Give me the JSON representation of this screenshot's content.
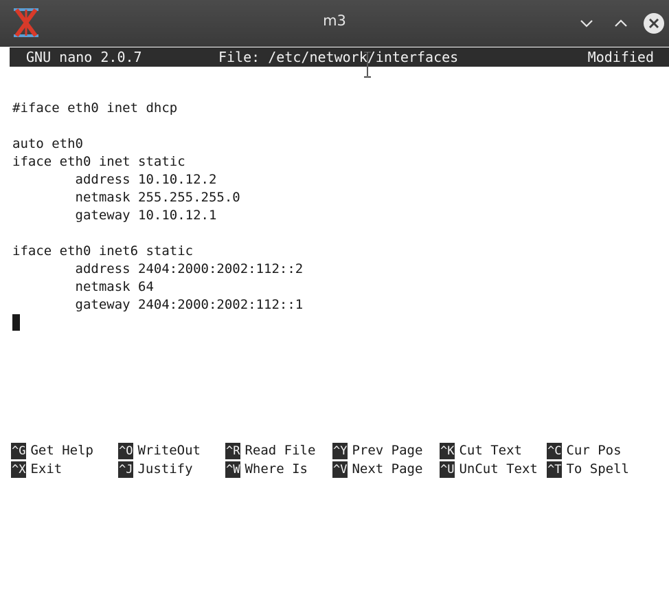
{
  "window": {
    "title": "m3",
    "icons": [
      "app-x-icon",
      "minimize-icon",
      "maximize-icon",
      "close-icon"
    ]
  },
  "nano": {
    "version": "GNU nano 2.0.7",
    "file": "File: /etc/network/interfaces",
    "status": "Modified"
  },
  "editor": {
    "lines": [
      "",
      "#iface eth0 inet dhcp",
      "",
      "auto eth0",
      "iface eth0 inet static",
      "        address 10.10.12.2",
      "        netmask 255.255.255.0",
      "        gateway 10.10.12.1",
      "",
      "iface eth0 inet6 static",
      "        address 2404:2000:2002:112::2",
      "        netmask 64",
      "        gateway 2404:2000:2002:112::1"
    ]
  },
  "shortcuts": {
    "row1": [
      {
        "key": "^G",
        "label": "Get Help"
      },
      {
        "key": "^O",
        "label": "WriteOut"
      },
      {
        "key": "^R",
        "label": "Read File"
      },
      {
        "key": "^Y",
        "label": "Prev Page"
      },
      {
        "key": "^K",
        "label": "Cut Text"
      },
      {
        "key": "^C",
        "label": "Cur Pos"
      }
    ],
    "row2": [
      {
        "key": "^X",
        "label": "Exit"
      },
      {
        "key": "^J",
        "label": "Justify"
      },
      {
        "key": "^W",
        "label": "Where Is"
      },
      {
        "key": "^V",
        "label": "Next Page"
      },
      {
        "key": "^U",
        "label": "UnCut Text"
      },
      {
        "key": "^T",
        "label": "To Spell"
      }
    ]
  },
  "colors": {
    "titlebar": "#3f3f3f",
    "nano_bar": "#2d2d2d",
    "text": "#1a1a1a",
    "background": "#ffffff",
    "icon_red": "#d83a2a"
  }
}
